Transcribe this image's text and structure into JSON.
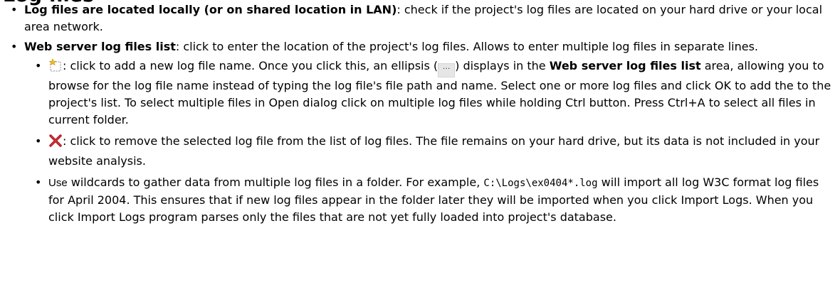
{
  "section_heading": "Log files",
  "items": [
    {
      "label": "Log files are located locally (or on shared location in LAN)",
      "text": ": check if the project's log files are located on your hard drive or your local area network."
    },
    {
      "label": "Web server log files list",
      "text": ": click to enter the location of the project's log files. Allows to enter multiple log files in separate lines."
    }
  ],
  "sub_items": {
    "add": {
      "icon": "add-file-icon",
      "text_a": ": click to add a new log file name. Once you click this, an ellipsis (",
      "ellipsis": "···",
      "text_b": ") displays in the ",
      "bold": "Web server log files list",
      "text_c": " area, allowing you to browse for the log file name instead of typing the log file's file path and name. Select one or more log files and click OK to add the to the project's list.  To select multiple files in Open dialog click on multiple log files while holding Ctrl button. Press Ctrl+A to select all files in current folder."
    },
    "remove": {
      "icon": "remove-file-icon",
      "text": ": click to remove the selected log file from the list of log files. The file remains on your hard drive, but its data is not included in your website analysis."
    },
    "wildcards": {
      "text_a": "Use",
      "text_b": " wildcards to gather data from multiple log files in a folder. For example, ",
      "code": "C:\\Logs\\ex0404*.log",
      "text_c": " will import all log W3C format log files for April 2004. This ensures that if new log files appear in the folder later they will be imported when you click Import Logs. When you click Import Logs program parses only the files that are not yet fully loaded into project's database."
    }
  }
}
